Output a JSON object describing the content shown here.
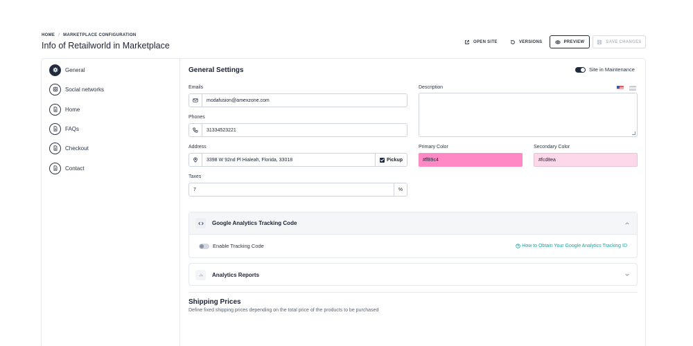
{
  "breadcrumb": {
    "home": "HOME",
    "separator": "/",
    "current": "MARKETPLACE CONFIGURATION"
  },
  "page_title": "Info of Retailworld in Marketplace",
  "header_actions": {
    "open_site": "OPEN SITE",
    "versions": "VERSIONS",
    "preview": "PREVIEW",
    "save_changes": "SAVE CHANGES"
  },
  "sidebar": {
    "items": [
      {
        "label": "General",
        "icon": "gear-icon",
        "active": true
      },
      {
        "label": "Social networks",
        "icon": "instagram-icon"
      },
      {
        "label": "Home",
        "icon": "document-icon"
      },
      {
        "label": "FAQs",
        "icon": "document-icon"
      },
      {
        "label": "Checkout",
        "icon": "document-icon"
      },
      {
        "label": "Contact",
        "icon": "document-icon"
      }
    ]
  },
  "general": {
    "title": "General Settings",
    "maintenance_label": "Site in Maintenance",
    "maintenance_on": true,
    "emails_label": "Emails",
    "email_value": "modafusion@amexzone.com",
    "phones_label": "Phones",
    "phone_value": "31334523221",
    "address_label": "Address",
    "address_value": "3398 W 92nd Pl Hialeah, Florida, 33018",
    "pickup_label": "Pickup",
    "taxes_label": "Taxes",
    "taxes_value": "7",
    "taxes_unit": "%",
    "description_label": "Description",
    "description_value": "",
    "primary_color_label": "Primary Color",
    "primary_color_value": "#ff89c4",
    "secondary_color_label": "Secondary Color",
    "secondary_color_value": "#fcd8ea"
  },
  "analytics": {
    "title": "Google Analytics Tracking Code",
    "enable_label": "Enable Tracking Code",
    "enabled": false,
    "help_link": "How to Obtain Your Google Analytics Tracking ID",
    "reports_title": "Analytics Reports"
  },
  "shipping": {
    "title": "Shipping Prices",
    "description": "Define fixed shipping prices depending on the total price of the products to be purchased"
  },
  "colors": {
    "accent": "#1f2a3d",
    "link": "#1aa3a3",
    "primary_swatch": "#ff89c4",
    "secondary_swatch": "#fcd8ea"
  }
}
